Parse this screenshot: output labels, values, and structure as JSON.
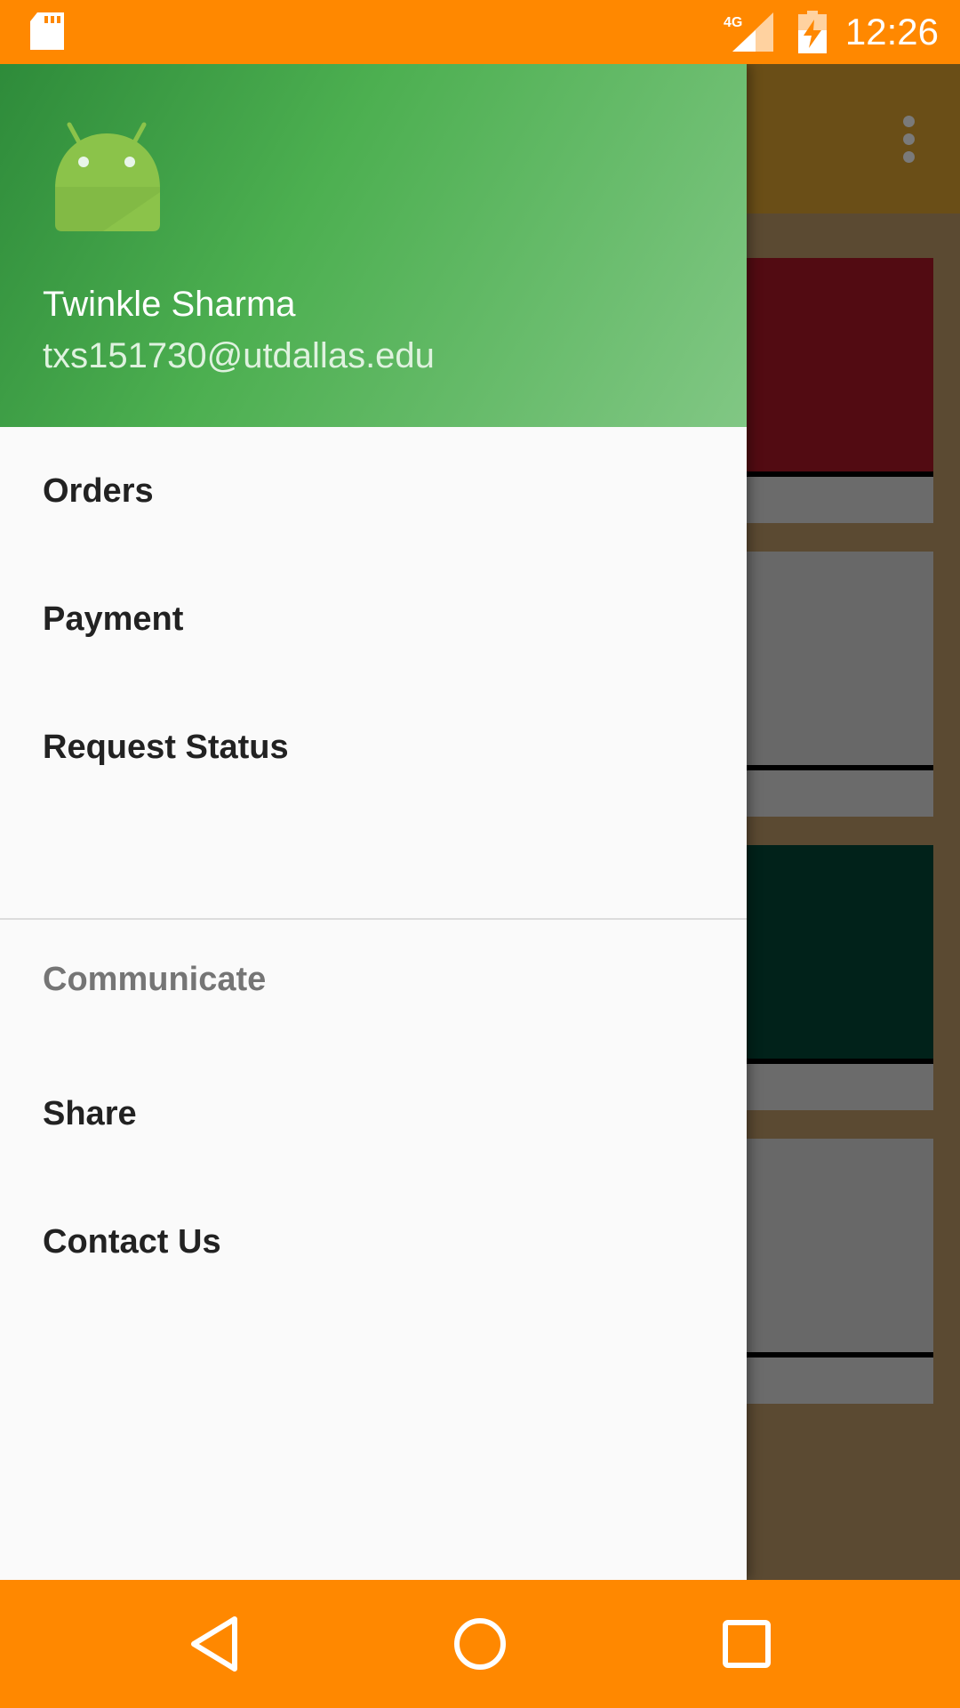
{
  "status_bar": {
    "network": "4G",
    "time": "12:26"
  },
  "drawer": {
    "header": {
      "name": "Twinkle Sharma",
      "email": "txs151730@utdallas.edu"
    },
    "items": [
      {
        "label": "Orders"
      },
      {
        "label": "Payment"
      },
      {
        "label": "Request Status"
      }
    ],
    "section": {
      "title": "Communicate",
      "items": [
        {
          "label": "Share"
        },
        {
          "label": "Contact Us"
        }
      ]
    }
  },
  "colors": {
    "status_bar": "#ff8800",
    "nav_bar": "#ff8800",
    "header_green": "#4caf50",
    "drawer_bg": "#fafafa"
  },
  "background_cards": [
    {
      "image_color": "#520b12"
    },
    {
      "image_color": "#686868"
    },
    {
      "image_color": "#01221a"
    },
    {
      "image_color": "#686868"
    }
  ]
}
